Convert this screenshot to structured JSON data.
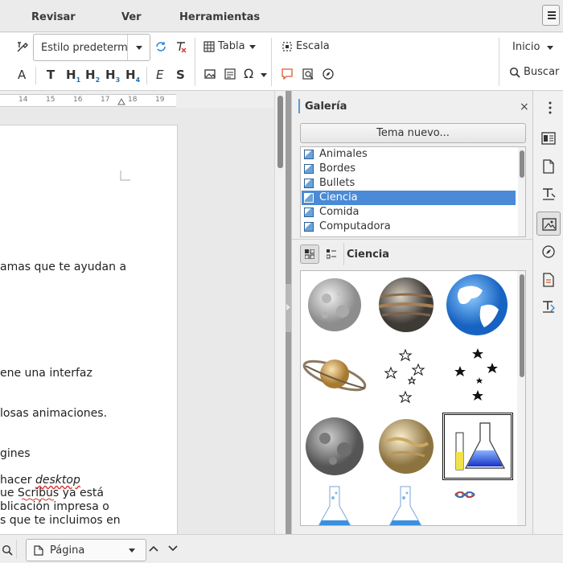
{
  "menubar": {
    "items": [
      "Revisar",
      "Ver",
      "Herramientas"
    ]
  },
  "toolbar": {
    "paragraph_style": "Estilo predetermi",
    "table_label": "Tabla",
    "scale_label": "Escala",
    "start_label": "Inicio",
    "search_label": "Buscar",
    "headings": [
      "T",
      "H",
      "H",
      "H",
      "H"
    ],
    "heading_subs": [
      "",
      "1",
      "2",
      "3",
      "4"
    ],
    "emphasis_glyph": "E",
    "strong_glyph": "S",
    "special_char_glyph": "Ω",
    "font_color_glyph": "A"
  },
  "ruler": {
    "ticks": [
      "14",
      "15",
      "16",
      "17",
      "18",
      "19"
    ]
  },
  "document": {
    "lines": [
      "amas que te ayudan a",
      "ene una interfaz",
      "losas animaciones.",
      "gines",
      "hacer",
      "ue Scribus ya está",
      "blicación impresa o",
      "s que te incluimos en"
    ],
    "italic_word": "desktop",
    "spelling_error_word": "Scribus"
  },
  "gallery": {
    "title": "Galería",
    "new_theme_button": "Tema nuevo...",
    "themes": [
      {
        "label": "Animales",
        "selected": false
      },
      {
        "label": "Bordes",
        "selected": false
      },
      {
        "label": "Bullets",
        "selected": false
      },
      {
        "label": "Ciencia",
        "selected": true
      },
      {
        "label": "Comida",
        "selected": false
      },
      {
        "label": "Computadora",
        "selected": false
      }
    ],
    "current_theme": "Ciencia",
    "items": [
      "moon-icon",
      "jupiter-icon",
      "earth-icon",
      "saturn-icon",
      "white-stars-icon",
      "black-stars-icon",
      "full-moon-icon",
      "venus-icon",
      "flask-icon",
      "beaker-left-icon",
      "beaker-right-icon",
      "dna-icon"
    ]
  },
  "sidebar_tabs": [
    "properties-icon",
    "page-icon",
    "styles-icon",
    "gallery-icon",
    "navigator-icon",
    "manage-changes-icon",
    "design-icon"
  ],
  "statusbar": {
    "page_label": "Página"
  },
  "colors": {
    "selection": "#4a8ad6",
    "heading_accent": "#1f6fb5",
    "comment_icon": "#e0582a"
  }
}
